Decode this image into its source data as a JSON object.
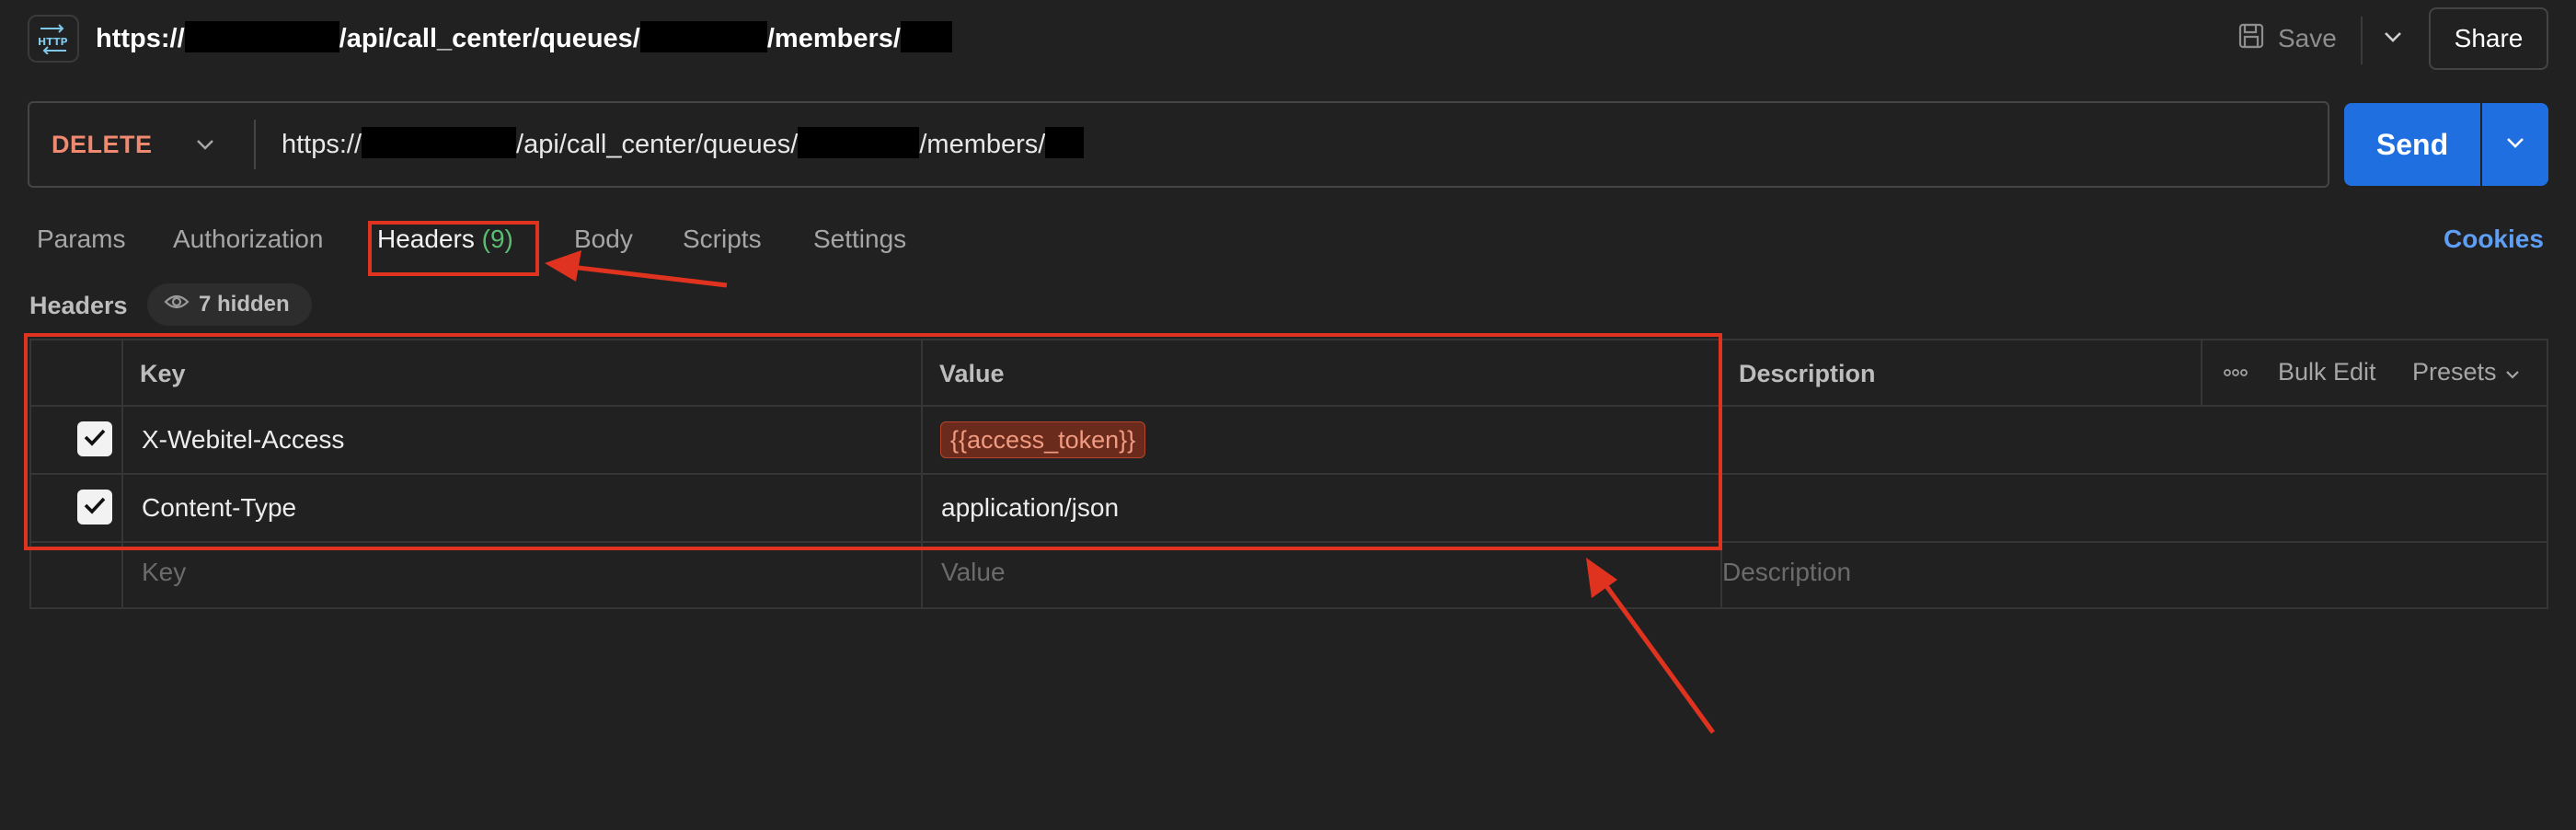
{
  "request": {
    "title_parts": [
      "https://",
      "/api/call_center/queues/",
      "/members/"
    ],
    "method": "DELETE",
    "url_parts": [
      "https://",
      "/api/call_center/queues/",
      "/members/"
    ]
  },
  "toolbar": {
    "save_label": "Save",
    "share_label": "Share",
    "send_label": "Send"
  },
  "tabs": [
    {
      "label": "Params"
    },
    {
      "label": "Authorization"
    },
    {
      "label": "Headers",
      "count": "(9)"
    },
    {
      "label": "Body"
    },
    {
      "label": "Scripts"
    },
    {
      "label": "Settings"
    }
  ],
  "cookies_label": "Cookies",
  "headers_section": {
    "label": "Headers",
    "hidden_badge": "7 hidden"
  },
  "table": {
    "columns": {
      "key": "Key",
      "value": "Value",
      "description": "Description"
    },
    "bulk_edit": "Bulk Edit",
    "presets": "Presets",
    "rows": [
      {
        "key": "X-Webitel-Access",
        "value": "{{access_token}}",
        "checked": true
      },
      {
        "key": "Content-Type",
        "value": "application/json",
        "checked": true
      }
    ],
    "placeholders": {
      "key": "Key",
      "value": "Value",
      "description": "Description"
    }
  },
  "colors": {
    "method": "#ef8a70",
    "send": "#1f6fe0",
    "cookies": "#5f9ef5",
    "tab_count": "#5bbd72",
    "annotation": "#e0331f"
  },
  "icons": [
    "http-icon",
    "save-icon",
    "chevron-down-icon",
    "eye-icon",
    "check-icon",
    "more-horizontal-icon"
  ]
}
